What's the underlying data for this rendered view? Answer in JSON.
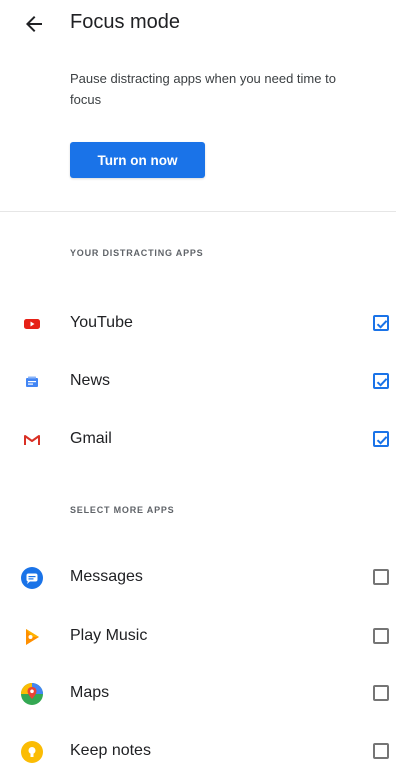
{
  "header": {
    "title": "Focus mode"
  },
  "description": "Pause distracting apps when you need time to focus",
  "action_button": "Turn on now",
  "sections": {
    "distracting_label": "YOUR DISTRACTING APPS",
    "more_label": "SELECT MORE APPS"
  },
  "distracting_apps": [
    {
      "name": "YouTube",
      "icon": "youtube-icon",
      "checked": true
    },
    {
      "name": "News",
      "icon": "news-icon",
      "checked": true
    },
    {
      "name": "Gmail",
      "icon": "gmail-icon",
      "checked": true
    }
  ],
  "more_apps": [
    {
      "name": "Messages",
      "icon": "messages-icon",
      "checked": false
    },
    {
      "name": "Play Music",
      "icon": "play-music-icon",
      "checked": false
    },
    {
      "name": "Maps",
      "icon": "maps-icon",
      "checked": false
    },
    {
      "name": "Keep notes",
      "icon": "keep-notes-icon",
      "checked": false
    }
  ],
  "colors": {
    "accent": "#1a73e8",
    "text": "#202124",
    "muted": "#5f6368"
  }
}
